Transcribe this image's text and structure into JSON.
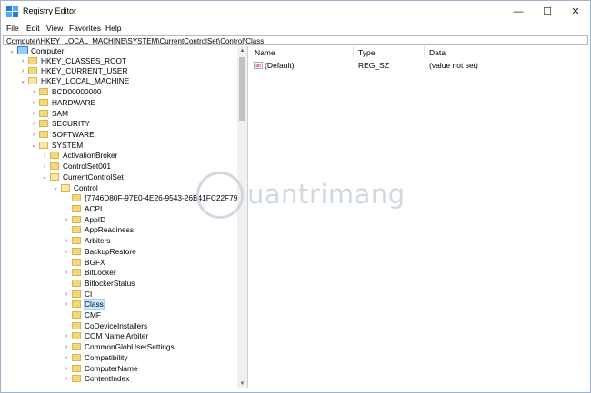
{
  "window": {
    "title": "Registry Editor",
    "minimize_glyph": "—",
    "maximize_glyph": "☐",
    "close_glyph": "✕"
  },
  "menu": [
    "File",
    "Edit",
    "View",
    "Favorites",
    "Help"
  ],
  "address": "Computer\\HKEY_LOCAL_MACHINE\\SYSTEM\\CurrentControlSet\\Control\\Class",
  "tree": [
    {
      "label": "Computer",
      "icon": "computer-icon",
      "expanded": true
    },
    {
      "label": "HKEY_CLASSES_ROOT",
      "icon": "folder-icon",
      "expanded": false
    },
    {
      "label": "HKEY_CURRENT_USER",
      "icon": "folder-icon",
      "expanded": false
    },
    {
      "label": "HKEY_LOCAL_MACHINE",
      "icon": "folder-icon",
      "expanded": true
    },
    {
      "label": "BCD00000000",
      "icon": "folder-icon",
      "expanded": false
    },
    {
      "label": "HARDWARE",
      "icon": "folder-icon",
      "expanded": false
    },
    {
      "label": "SAM",
      "icon": "folder-icon",
      "expanded": false
    },
    {
      "label": "SECURITY",
      "icon": "folder-icon",
      "expanded": false
    },
    {
      "label": "SOFTWARE",
      "icon": "folder-icon",
      "expanded": false
    },
    {
      "label": "SYSTEM",
      "icon": "folder-icon",
      "expanded": true
    },
    {
      "label": "ActivationBroker",
      "icon": "folder-icon",
      "expanded": false
    },
    {
      "label": "ControlSet001",
      "icon": "folder-icon",
      "expanded": false
    },
    {
      "label": "CurrentControlSet",
      "icon": "folder-icon",
      "expanded": true
    },
    {
      "label": "Control",
      "icon": "folder-icon",
      "expanded": true
    },
    {
      "label": "{7746D80F-97E0-4E26-9543-26B41FC22F79}",
      "icon": "folder-icon",
      "expanded": false
    },
    {
      "label": "ACPI",
      "icon": "folder-icon",
      "expanded": false
    },
    {
      "label": "AppID",
      "icon": "folder-icon",
      "expanded": false
    },
    {
      "label": "AppReadiness",
      "icon": "folder-icon",
      "expanded": false
    },
    {
      "label": "Arbiters",
      "icon": "folder-icon",
      "expanded": false
    },
    {
      "label": "BackupRestore",
      "icon": "folder-icon",
      "expanded": false
    },
    {
      "label": "BGFX",
      "icon": "folder-icon",
      "expanded": false
    },
    {
      "label": "BitLocker",
      "icon": "folder-icon",
      "expanded": false
    },
    {
      "label": "BitlockerStatus",
      "icon": "folder-icon",
      "expanded": false
    },
    {
      "label": "CI",
      "icon": "folder-icon",
      "expanded": false
    },
    {
      "label": "Class",
      "icon": "folder-icon",
      "expanded": false,
      "selected": true
    },
    {
      "label": "CMF",
      "icon": "folder-icon",
      "expanded": false
    },
    {
      "label": "CoDeviceInstallers",
      "icon": "folder-icon",
      "expanded": false
    },
    {
      "label": "COM Name Arbiter",
      "icon": "folder-icon",
      "expanded": false
    },
    {
      "label": "CommonGlobUserSettings",
      "icon": "folder-icon",
      "expanded": false
    },
    {
      "label": "Compatibility",
      "icon": "folder-icon",
      "expanded": false
    },
    {
      "label": "ComputerName",
      "icon": "folder-icon",
      "expanded": false
    },
    {
      "label": "ContentIndex",
      "icon": "folder-icon",
      "expanded": false
    }
  ],
  "list": {
    "columns": [
      "Name",
      "Type",
      "Data"
    ],
    "rows": [
      {
        "name": "(Default)",
        "type": "REG_SZ",
        "data": "(value not set)",
        "icon": "string-value-icon"
      }
    ]
  },
  "watermark": "uantrimang"
}
